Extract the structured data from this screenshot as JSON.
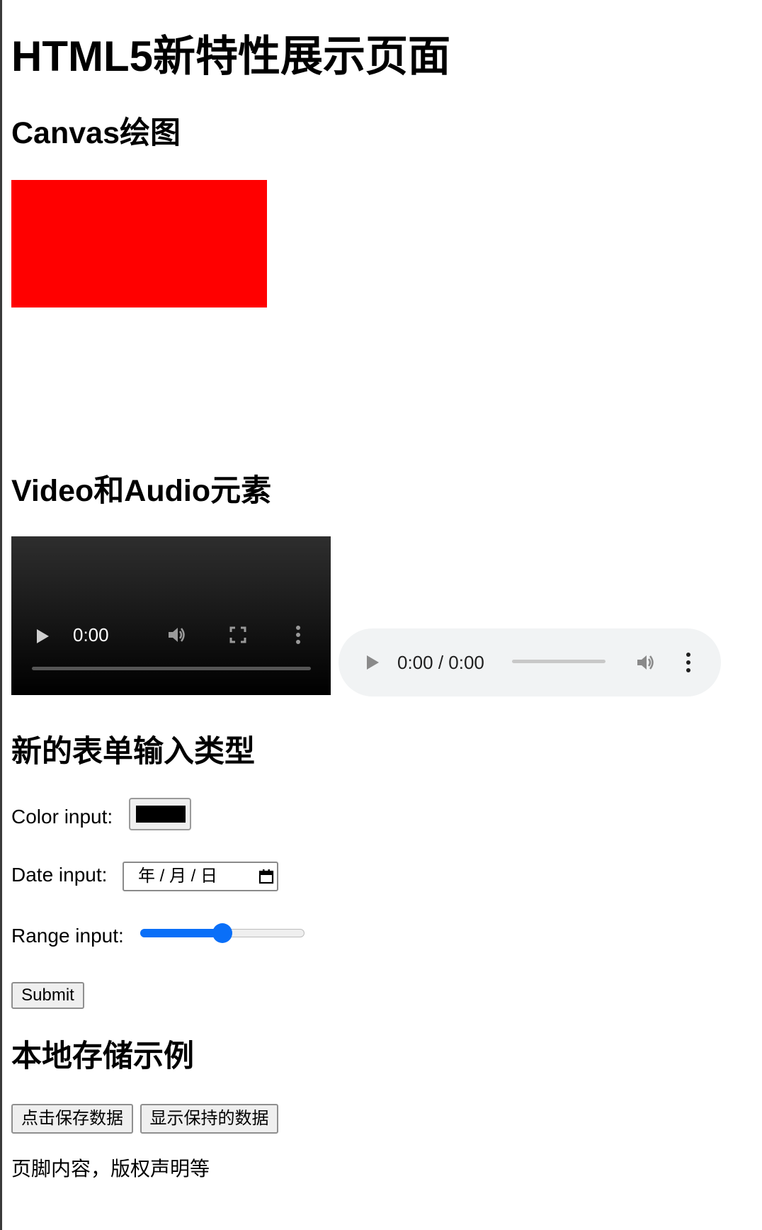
{
  "page": {
    "title": "HTML5新特性展示页面"
  },
  "canvas_section": {
    "heading": "Canvas绘图",
    "rect_color": "#ff0000"
  },
  "media_section": {
    "heading": "Video和Audio元素",
    "video": {
      "time": "0:00"
    },
    "audio": {
      "time": "0:00 / 0:00"
    }
  },
  "form_section": {
    "heading": "新的表单输入类型",
    "color_label": "Color input:",
    "color_value": "#000000",
    "date_label": "Date input:",
    "date_placeholder": "年 / 月 / 日",
    "range_label": "Range input:",
    "range_value": 0.5,
    "submit_label": "Submit"
  },
  "storage_section": {
    "heading": "本地存储示例",
    "save_button": "点击保存数据",
    "show_button": "显示保持的数据"
  },
  "footer": {
    "text": "页脚内容，版权声明等"
  },
  "colors": {
    "accent": "#0a6ff8",
    "button_bg": "#efefef"
  }
}
